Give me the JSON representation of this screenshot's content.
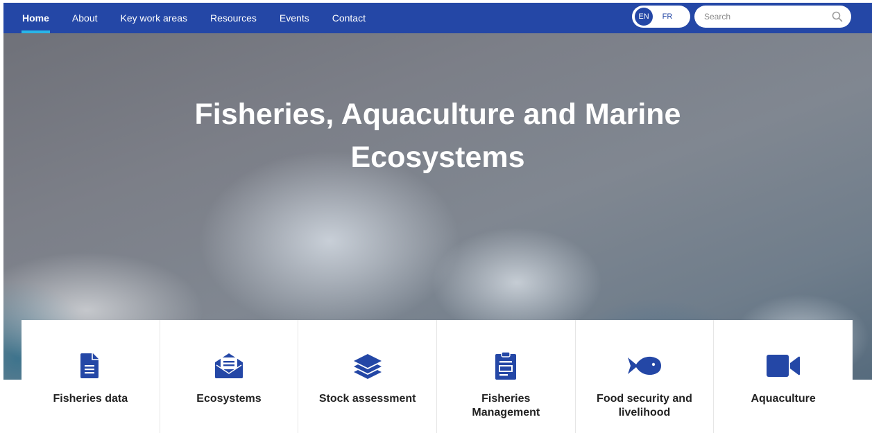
{
  "nav": {
    "items": [
      {
        "label": "Home",
        "active": true
      },
      {
        "label": "About"
      },
      {
        "label": "Key work areas"
      },
      {
        "label": "Resources"
      },
      {
        "label": "Events"
      },
      {
        "label": "Contact"
      }
    ]
  },
  "language": {
    "options": [
      "EN",
      "FR"
    ],
    "selected": "EN"
  },
  "search": {
    "placeholder": "Search",
    "value": "",
    "icon": "search-icon"
  },
  "hero": {
    "title_line1": "Fisheries, Aquaculture and Marine",
    "title_line2": "Ecosystems"
  },
  "cards": [
    {
      "label": "Fisheries data",
      "icon": "document-icon"
    },
    {
      "label": "Ecosystems",
      "icon": "envelope-open-icon"
    },
    {
      "label": "Stock assessment",
      "icon": "layers-icon"
    },
    {
      "label": "Fisheries Management",
      "icon": "clipboard-icon"
    },
    {
      "label": "Food security and livelihood",
      "icon": "fish-icon"
    },
    {
      "label": "Aquaculture",
      "icon": "video-camera-icon"
    }
  ],
  "colors": {
    "nav_bg": "#2447a6",
    "nav_active_underline": "#29b6e8",
    "icon_color": "#2447a6",
    "text_dark": "#222222"
  }
}
